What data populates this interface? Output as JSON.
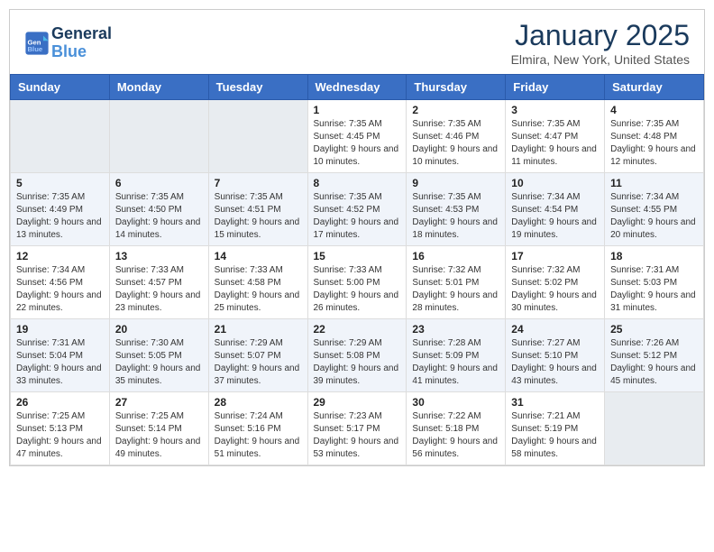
{
  "logo": {
    "text_general": "General",
    "text_blue": "Blue",
    "icon_alt": "GeneralBlue logo"
  },
  "header": {
    "main_title": "January 2025",
    "subtitle": "Elmira, New York, United States"
  },
  "weekdays": [
    "Sunday",
    "Monday",
    "Tuesday",
    "Wednesday",
    "Thursday",
    "Friday",
    "Saturday"
  ],
  "weeks": [
    [
      {
        "day": "",
        "empty": true
      },
      {
        "day": "",
        "empty": true
      },
      {
        "day": "",
        "empty": true
      },
      {
        "day": "1",
        "sunrise": "7:35 AM",
        "sunset": "4:45 PM",
        "daylight": "9 hours and 10 minutes."
      },
      {
        "day": "2",
        "sunrise": "7:35 AM",
        "sunset": "4:46 PM",
        "daylight": "9 hours and 10 minutes."
      },
      {
        "day": "3",
        "sunrise": "7:35 AM",
        "sunset": "4:47 PM",
        "daylight": "9 hours and 11 minutes."
      },
      {
        "day": "4",
        "sunrise": "7:35 AM",
        "sunset": "4:48 PM",
        "daylight": "9 hours and 12 minutes."
      }
    ],
    [
      {
        "day": "5",
        "sunrise": "7:35 AM",
        "sunset": "4:49 PM",
        "daylight": "9 hours and 13 minutes."
      },
      {
        "day": "6",
        "sunrise": "7:35 AM",
        "sunset": "4:50 PM",
        "daylight": "9 hours and 14 minutes."
      },
      {
        "day": "7",
        "sunrise": "7:35 AM",
        "sunset": "4:51 PM",
        "daylight": "9 hours and 15 minutes."
      },
      {
        "day": "8",
        "sunrise": "7:35 AM",
        "sunset": "4:52 PM",
        "daylight": "9 hours and 17 minutes."
      },
      {
        "day": "9",
        "sunrise": "7:35 AM",
        "sunset": "4:53 PM",
        "daylight": "9 hours and 18 minutes."
      },
      {
        "day": "10",
        "sunrise": "7:34 AM",
        "sunset": "4:54 PM",
        "daylight": "9 hours and 19 minutes."
      },
      {
        "day": "11",
        "sunrise": "7:34 AM",
        "sunset": "4:55 PM",
        "daylight": "9 hours and 20 minutes."
      }
    ],
    [
      {
        "day": "12",
        "sunrise": "7:34 AM",
        "sunset": "4:56 PM",
        "daylight": "9 hours and 22 minutes."
      },
      {
        "day": "13",
        "sunrise": "7:33 AM",
        "sunset": "4:57 PM",
        "daylight": "9 hours and 23 minutes."
      },
      {
        "day": "14",
        "sunrise": "7:33 AM",
        "sunset": "4:58 PM",
        "daylight": "9 hours and 25 minutes."
      },
      {
        "day": "15",
        "sunrise": "7:33 AM",
        "sunset": "5:00 PM",
        "daylight": "9 hours and 26 minutes."
      },
      {
        "day": "16",
        "sunrise": "7:32 AM",
        "sunset": "5:01 PM",
        "daylight": "9 hours and 28 minutes."
      },
      {
        "day": "17",
        "sunrise": "7:32 AM",
        "sunset": "5:02 PM",
        "daylight": "9 hours and 30 minutes."
      },
      {
        "day": "18",
        "sunrise": "7:31 AM",
        "sunset": "5:03 PM",
        "daylight": "9 hours and 31 minutes."
      }
    ],
    [
      {
        "day": "19",
        "sunrise": "7:31 AM",
        "sunset": "5:04 PM",
        "daylight": "9 hours and 33 minutes."
      },
      {
        "day": "20",
        "sunrise": "7:30 AM",
        "sunset": "5:05 PM",
        "daylight": "9 hours and 35 minutes."
      },
      {
        "day": "21",
        "sunrise": "7:29 AM",
        "sunset": "5:07 PM",
        "daylight": "9 hours and 37 minutes."
      },
      {
        "day": "22",
        "sunrise": "7:29 AM",
        "sunset": "5:08 PM",
        "daylight": "9 hours and 39 minutes."
      },
      {
        "day": "23",
        "sunrise": "7:28 AM",
        "sunset": "5:09 PM",
        "daylight": "9 hours and 41 minutes."
      },
      {
        "day": "24",
        "sunrise": "7:27 AM",
        "sunset": "5:10 PM",
        "daylight": "9 hours and 43 minutes."
      },
      {
        "day": "25",
        "sunrise": "7:26 AM",
        "sunset": "5:12 PM",
        "daylight": "9 hours and 45 minutes."
      }
    ],
    [
      {
        "day": "26",
        "sunrise": "7:25 AM",
        "sunset": "5:13 PM",
        "daylight": "9 hours and 47 minutes."
      },
      {
        "day": "27",
        "sunrise": "7:25 AM",
        "sunset": "5:14 PM",
        "daylight": "9 hours and 49 minutes."
      },
      {
        "day": "28",
        "sunrise": "7:24 AM",
        "sunset": "5:16 PM",
        "daylight": "9 hours and 51 minutes."
      },
      {
        "day": "29",
        "sunrise": "7:23 AM",
        "sunset": "5:17 PM",
        "daylight": "9 hours and 53 minutes."
      },
      {
        "day": "30",
        "sunrise": "7:22 AM",
        "sunset": "5:18 PM",
        "daylight": "9 hours and 56 minutes."
      },
      {
        "day": "31",
        "sunrise": "7:21 AM",
        "sunset": "5:19 PM",
        "daylight": "9 hours and 58 minutes."
      },
      {
        "day": "",
        "empty": true
      }
    ]
  ],
  "labels": {
    "sunrise": "Sunrise:",
    "sunset": "Sunset:",
    "daylight": "Daylight:"
  }
}
